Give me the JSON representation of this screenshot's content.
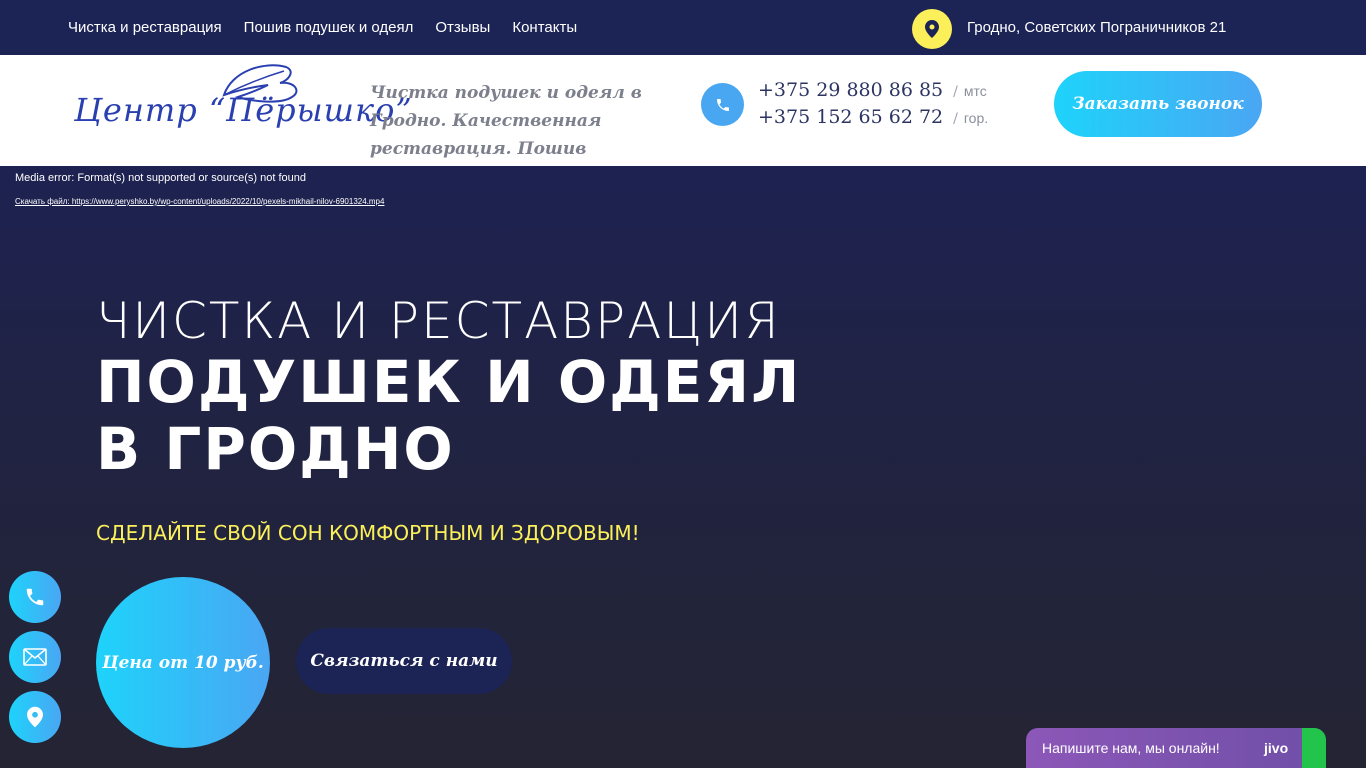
{
  "topbar": {
    "nav": [
      {
        "label": "Чистка и реставрация"
      },
      {
        "label": "Пошив подушек и одеял"
      },
      {
        "label": "Отзывы"
      },
      {
        "label": "Контакты"
      }
    ],
    "address": "Гродно, Советских Пограничников 21"
  },
  "header": {
    "logo_text": "Центр “Пёрышко”",
    "tagline": "Чистка подушек и одеял в Гродно. Качественная реставрация. Пошив",
    "phones": [
      {
        "number": "+375 29 880 86 85",
        "sep": "/",
        "operator": "мтс"
      },
      {
        "number": "+375 152 65 62 72",
        "sep": "/",
        "operator": "гор."
      }
    ],
    "order_button": "Заказать звонок"
  },
  "hero": {
    "media_error": "Media error: Format(s) not supported or source(s) not found",
    "media_link": "Скачать файл: https://www.peryshko.by/wp-content/uploads/2022/10/pexels-mikhail-nilov-6901324.mp4",
    "title_line1": "ЧИСТКА И РЕСТАВРАЦИЯ",
    "title_line2": "ПОДУШЕК И ОДЕЯЛ",
    "title_line3": "В ГРОДНО",
    "subtitle": "СДЕЛАЙТЕ СВОЙ СОН КОМФОРТНЫМ И ЗДОРОВЫМ!",
    "price": "Цена от 10 руб.",
    "contact_button": "Связаться с нами"
  },
  "float_buttons": [
    "phone-icon",
    "mail-icon",
    "location-pin-icon"
  ],
  "chat": {
    "text": "Напишите нам, мы онлайн!",
    "brand": "jivo"
  },
  "colors": {
    "nav_bg": "#1c2355",
    "accent_yellow": "#fbf05a",
    "gradient_start": "#1ed3fb",
    "gradient_end": "#4aa6f3",
    "chat_purple": "#8c57b8"
  }
}
